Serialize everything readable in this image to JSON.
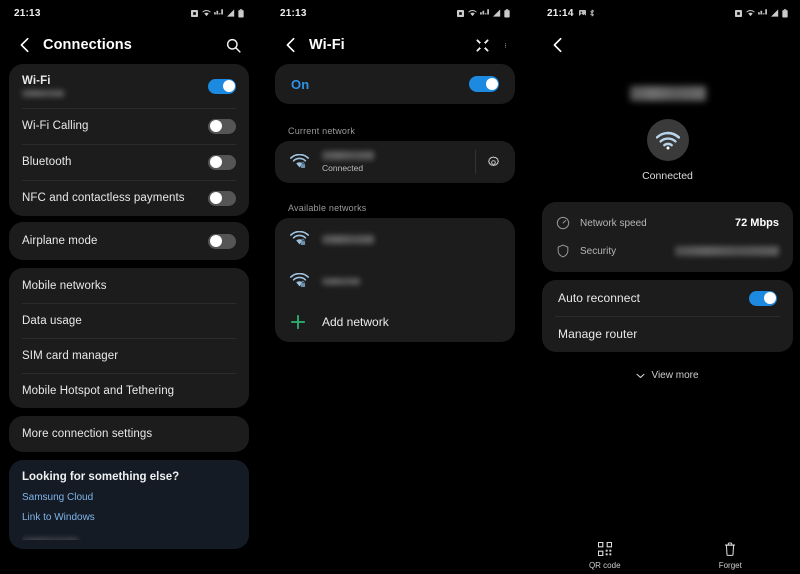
{
  "colors": {
    "accent_blue": "#1c8ae0",
    "link_blue": "#7fb4e8",
    "add_green": "#2bb673",
    "card_bg": "#1c1c1c",
    "help_card_bg": "#141b25",
    "screen_bg": "#000000"
  },
  "panel1": {
    "status": {
      "time": "21:13",
      "icons": [
        "sim-icon",
        "wifi-icon",
        "network-icon",
        "signal-icon",
        "battery-icon"
      ]
    },
    "appbar": {
      "back": "back-arrow-icon",
      "title": "Connections",
      "action": "search-icon"
    },
    "group1": [
      {
        "label": "Wi-Fi",
        "sublabel_redacted": true,
        "toggle": "on"
      },
      {
        "label": "Wi-Fi Calling",
        "toggle": "off"
      },
      {
        "label": "Bluetooth",
        "toggle": "off"
      },
      {
        "label": "NFC and contactless payments",
        "toggle": "off"
      }
    ],
    "group2": [
      {
        "label": "Airplane mode",
        "toggle": "off"
      }
    ],
    "group3": [
      {
        "label": "Mobile networks"
      },
      {
        "label": "Data usage"
      },
      {
        "label": "SIM card manager"
      },
      {
        "label": "Mobile Hotspot and Tethering"
      }
    ],
    "group4": [
      {
        "label": "More connection settings"
      }
    ],
    "help": {
      "heading": "Looking for something else?",
      "links": [
        "Samsung Cloud",
        "Link to Windows"
      ]
    }
  },
  "panel2": {
    "status": {
      "time": "21:13",
      "icons": [
        "sim-icon",
        "wifi-icon",
        "network-icon",
        "signal-icon",
        "battery-icon"
      ]
    },
    "appbar": {
      "back": "back-arrow-icon",
      "title": "Wi-Fi",
      "action1": "smart-view-icon",
      "action2": "overflow-menu-icon"
    },
    "power": {
      "label": "On",
      "toggle": "on"
    },
    "current_section": "Current network",
    "current_network": {
      "ssid_redacted": true,
      "status": "Connected",
      "gear": "gear-icon"
    },
    "available_section": "Available networks",
    "available_networks": [
      {
        "ssid_redacted": true
      },
      {
        "ssid_redacted": true
      }
    ],
    "add_network": {
      "label": "Add network",
      "icon": "plus-icon"
    }
  },
  "panel3": {
    "status": {
      "time": "21:14",
      "left_icons": [
        "gallery-icon",
        "bluetooth-icon"
      ],
      "icons": [
        "sim-icon",
        "wifi-icon",
        "network-icon",
        "signal-icon",
        "battery-icon"
      ]
    },
    "appbar": {
      "back": "back-arrow-icon"
    },
    "hero": {
      "ssid_redacted": true,
      "icon": "wifi-icon",
      "status": "Connected"
    },
    "info": [
      {
        "icon": "speedometer-icon",
        "key": "Network speed",
        "value": "72 Mbps"
      },
      {
        "icon": "shield-icon",
        "key": "Security",
        "value_redacted": true
      }
    ],
    "settings": [
      {
        "label": "Auto reconnect",
        "toggle": "on"
      },
      {
        "label": "Manage router"
      }
    ],
    "view_more": {
      "label": "View more",
      "icon": "chevron-down-icon"
    },
    "actions": [
      {
        "icon": "qr-code-icon",
        "label": "QR code"
      },
      {
        "icon": "trash-icon",
        "label": "Forget"
      }
    ]
  }
}
